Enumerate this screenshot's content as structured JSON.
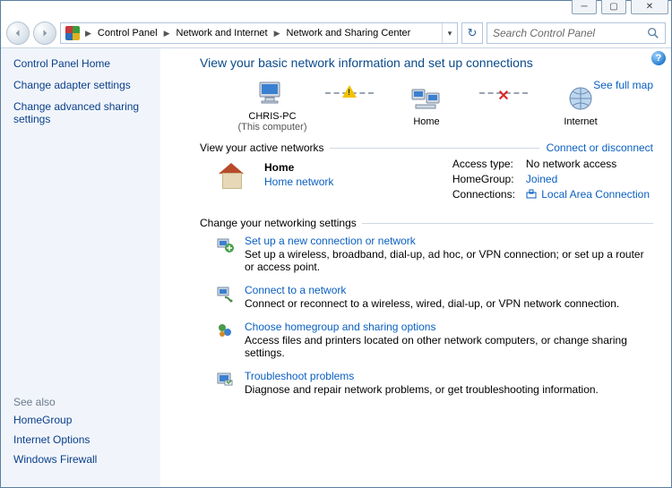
{
  "window_controls": {
    "min": "─",
    "max": "▢",
    "close": "✕"
  },
  "breadcrumb": {
    "items": [
      "Control Panel",
      "Network and Internet",
      "Network and Sharing Center"
    ]
  },
  "search": {
    "placeholder": "Search Control Panel"
  },
  "sidebar": {
    "home": "Control Panel Home",
    "links": [
      "Change adapter settings",
      "Change advanced sharing settings"
    ],
    "seealso_heading": "See also",
    "seealso": [
      "HomeGroup",
      "Internet Options",
      "Windows Firewall"
    ]
  },
  "page_title": "View your basic network information and set up connections",
  "see_full_map": "See full map",
  "netmap": {
    "items": [
      {
        "label": "CHRIS-PC",
        "sub": "(This computer)"
      },
      {
        "label": "Home",
        "sub": ""
      },
      {
        "label": "Internet",
        "sub": ""
      }
    ]
  },
  "active_heading": "View your active networks",
  "connect_link": "Connect or disconnect",
  "active_net": {
    "name": "Home",
    "type": "Home network",
    "access_type_label": "Access type:",
    "access_type_value": "No network access",
    "homegroup_label": "HomeGroup:",
    "homegroup_value": "Joined",
    "connections_label": "Connections:",
    "connections_value": "Local Area Connection"
  },
  "change_heading": "Change your networking settings",
  "settings": [
    {
      "title": "Set up a new connection or network",
      "desc": "Set up a wireless, broadband, dial-up, ad hoc, or VPN connection; or set up a router or access point."
    },
    {
      "title": "Connect to a network",
      "desc": "Connect or reconnect to a wireless, wired, dial-up, or VPN network connection."
    },
    {
      "title": "Choose homegroup and sharing options",
      "desc": "Access files and printers located on other network computers, or change sharing settings."
    },
    {
      "title": "Troubleshoot problems",
      "desc": "Diagnose and repair network problems, or get troubleshooting information."
    }
  ]
}
